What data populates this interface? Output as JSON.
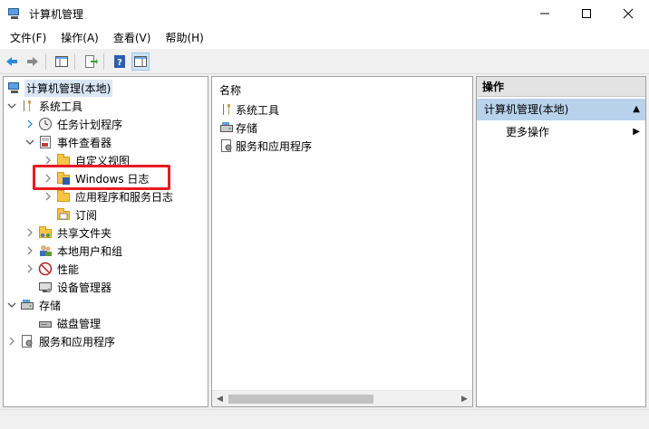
{
  "window": {
    "title": "计算机管理"
  },
  "menu": [
    "文件(F)",
    "操作(A)",
    "查看(V)",
    "帮助(H)"
  ],
  "tree": {
    "root": "计算机管理(本地)",
    "system_tools": "系统工具",
    "task_scheduler": "任务计划程序",
    "event_viewer": "事件查看器",
    "custom_views": "自定义视图",
    "windows_logs": "Windows 日志",
    "app_service_logs": "应用程序和服务日志",
    "subscriptions": "订阅",
    "shared_folders": "共享文件夹",
    "local_users": "本地用户和组",
    "performance": "性能",
    "device_manager": "设备管理器",
    "storage": "存储",
    "disk_management": "磁盘管理",
    "services_apps": "服务和应用程序"
  },
  "middle": {
    "header": "名称",
    "items": [
      "系统工具",
      "存储",
      "服务和应用程序"
    ]
  },
  "actions": {
    "header": "操作",
    "section": "计算机管理(本地)",
    "more": "更多操作"
  },
  "colors": {
    "highlight_box": "#e81b23",
    "section_bg": "#b8d2ec"
  }
}
